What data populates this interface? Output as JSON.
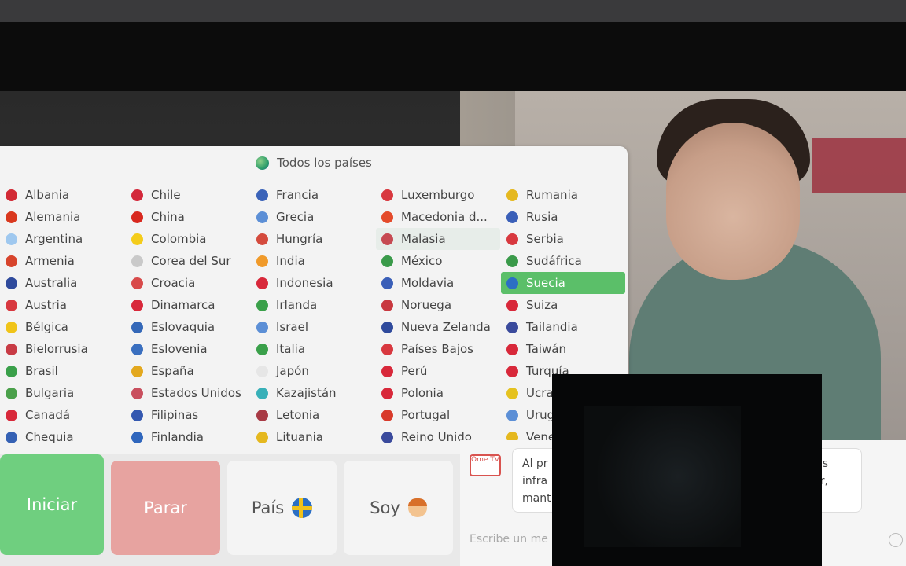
{
  "panel": {
    "all_countries": "Todos los países",
    "columns": [
      [
        {
          "name": "Albania",
          "color": "#d22a35"
        },
        {
          "name": "Alemania",
          "color": "#d9381e"
        },
        {
          "name": "Argentina",
          "color": "#9fc8ef"
        },
        {
          "name": "Armenia",
          "color": "#d7442c"
        },
        {
          "name": "Australia",
          "color": "#2f4a9c"
        },
        {
          "name": "Austria",
          "color": "#d8383f"
        },
        {
          "name": "Bélgica",
          "color": "#f0c419"
        },
        {
          "name": "Bielorrusia",
          "color": "#c83b45"
        },
        {
          "name": "Brasil",
          "color": "#3aa04a"
        },
        {
          "name": "Bulgaria",
          "color": "#4aa04a"
        },
        {
          "name": "Canadá",
          "color": "#d8283a"
        },
        {
          "name": "Chequia",
          "color": "#3561b4"
        }
      ],
      [
        {
          "name": "Chile",
          "color": "#d3283a"
        },
        {
          "name": "China",
          "color": "#d8281e"
        },
        {
          "name": "Colombia",
          "color": "#f4cc1a"
        },
        {
          "name": "Corea del Sur",
          "color": "#c9c9c9"
        },
        {
          "name": "Croacia",
          "color": "#d84a4a"
        },
        {
          "name": "Dinamarca",
          "color": "#d8283a"
        },
        {
          "name": "Eslovaquia",
          "color": "#3468b8"
        },
        {
          "name": "Eslovenia",
          "color": "#3a6fbf"
        },
        {
          "name": "España",
          "color": "#e3a81e"
        },
        {
          "name": "Estados Unidos",
          "color": "#c94f5e"
        },
        {
          "name": "Filipinas",
          "color": "#3458b0"
        },
        {
          "name": "Finlandia",
          "color": "#2f66bd"
        }
      ],
      [
        {
          "name": "Francia",
          "color": "#3b63b9"
        },
        {
          "name": "Grecia",
          "color": "#5c8fd6"
        },
        {
          "name": "Hungría",
          "color": "#d44a3d"
        },
        {
          "name": "India",
          "color": "#f09a2a"
        },
        {
          "name": "Indonesia",
          "color": "#d8283a"
        },
        {
          "name": "Irlanda",
          "color": "#3aa04a"
        },
        {
          "name": "Israel",
          "color": "#5c8fd6"
        },
        {
          "name": "Italia",
          "color": "#3aa04a"
        },
        {
          "name": "Japón",
          "color": "#e6e6e6"
        },
        {
          "name": "Kazajistán",
          "color": "#38b0b8"
        },
        {
          "name": "Letonia",
          "color": "#a83a45"
        },
        {
          "name": "Lituania",
          "color": "#e5b81f"
        }
      ],
      [
        {
          "name": "Luxemburgo",
          "color": "#d8383f"
        },
        {
          "name": "Macedonia d...",
          "color": "#e44a2a"
        },
        {
          "name": "Malasia",
          "color": "#c64a52"
        },
        {
          "name": "México",
          "color": "#3a9a4a"
        },
        {
          "name": "Moldavia",
          "color": "#3a5fb8"
        },
        {
          "name": "Noruega",
          "color": "#c8383f"
        },
        {
          "name": "Nueva Zelanda",
          "color": "#2f4a9c"
        },
        {
          "name": "Países Bajos",
          "color": "#d8383f"
        },
        {
          "name": "Perú",
          "color": "#d8283a"
        },
        {
          "name": "Polonia",
          "color": "#d8283a"
        },
        {
          "name": "Portugal",
          "color": "#d83a2a"
        },
        {
          "name": "Reino Unido",
          "color": "#3a4a9c"
        }
      ],
      [
        {
          "name": "Rumania",
          "color": "#e5b81f"
        },
        {
          "name": "Rusia",
          "color": "#3a5fb8"
        },
        {
          "name": "Serbia",
          "color": "#d8383f"
        },
        {
          "name": "Sudáfrica",
          "color": "#3a9a4a"
        },
        {
          "name": "Suecia",
          "color": "#2c6fc4"
        },
        {
          "name": "Suiza",
          "color": "#d8283a"
        },
        {
          "name": "Tailandia",
          "color": "#3a4a9c"
        },
        {
          "name": "Taiwán",
          "color": "#d8283a"
        },
        {
          "name": "Turquía",
          "color": "#d8283a"
        },
        {
          "name": "Ucra",
          "color": "#e5c21f"
        },
        {
          "name": "Urug",
          "color": "#5c8fd6"
        },
        {
          "name": "Vene",
          "color": "#e5b81f"
        }
      ]
    ],
    "selected": "Suecia",
    "hovered": "Malasia"
  },
  "controls": {
    "start": "Iniciar",
    "stop": "Parar",
    "country": "País",
    "gender": "Soy"
  },
  "chat": {
    "logo": "Ome TV",
    "message_lines": [
      "Al pr",
      "infra",
      "mant"
    ],
    "message_right": [
      "os",
      "r,"
    ],
    "input_placeholder": "Escribe un me"
  }
}
